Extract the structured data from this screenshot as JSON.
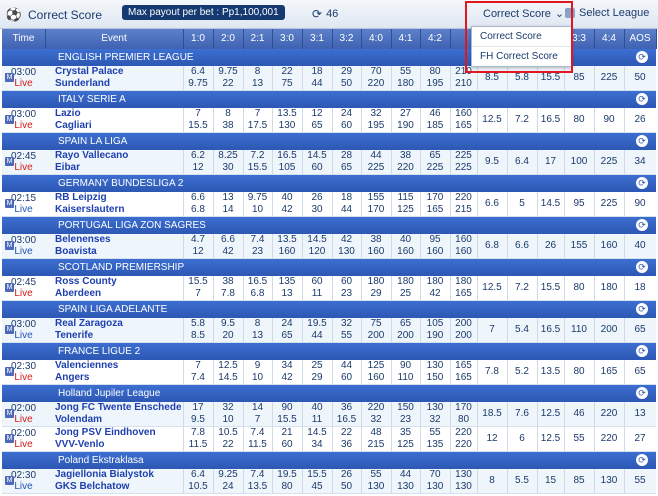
{
  "topbar": {
    "title": "Correct Score",
    "max_payout": "Max payout per bet : Pp1,100,001",
    "refresh_count": "46",
    "dropdown_label": "Correct Score",
    "select_league": "Select League"
  },
  "dropdown_menu": {
    "items": [
      "Correct Score",
      "FH Correct Score"
    ]
  },
  "columns": [
    "Time",
    "Event",
    "1:0",
    "2:0",
    "2:1",
    "3:0",
    "3:1",
    "3:2",
    "4:0",
    "4:1",
    "4:2",
    "",
    "",
    "",
    "",
    "3:3",
    "4:4",
    "AOS"
  ],
  "leagues": [
    {
      "name": "ENGLISH PREMIER LEAGUE",
      "matches": [
        {
          "time": "03:00",
          "status": "Live",
          "home": "Crystal Palace",
          "away": "Sunderland",
          "home_odds": [
            "6.4",
            "9.75",
            "8",
            "22",
            "18",
            "29",
            "70",
            "55",
            "80",
            "210"
          ],
          "away_odds": [
            "9.75",
            "22",
            "13",
            "75",
            "44",
            "50",
            "220",
            "180",
            "195",
            "210"
          ],
          "extra": [
            "8.5",
            "5.8",
            "15.5",
            "85",
            "225",
            "50"
          ]
        }
      ]
    },
    {
      "name": "ITALY SERIE A",
      "matches": [
        {
          "time": "03:00",
          "status": "Live",
          "home": "Lazio",
          "away": "Cagliari",
          "home_odds": [
            "7",
            "8",
            "7",
            "13.5",
            "12",
            "24",
            "32",
            "27",
            "46",
            "160"
          ],
          "away_odds": [
            "15.5",
            "38",
            "17.5",
            "130",
            "65",
            "60",
            "195",
            "190",
            "185",
            "165"
          ],
          "extra": [
            "12.5",
            "7.2",
            "16.5",
            "80",
            "90",
            "26"
          ]
        }
      ]
    },
    {
      "name": "SPAIN LA LIGA",
      "matches": [
        {
          "time": "02:45",
          "status": "Live",
          "home": "Rayo Vallecano",
          "away": "Eibar",
          "home_odds": [
            "6.2",
            "8.25",
            "7.2",
            "16.5",
            "14.5",
            "28",
            "44",
            "38",
            "65",
            "225"
          ],
          "away_odds": [
            "12",
            "30",
            "15.5",
            "105",
            "60",
            "65",
            "225",
            "220",
            "225",
            "225"
          ],
          "extra": [
            "9.5",
            "6.4",
            "17",
            "100",
            "225",
            "34"
          ]
        }
      ]
    },
    {
      "name": "GERMANY BUNDESLIGA 2",
      "matches": [
        {
          "time": "02:15",
          "status": "Live",
          "home": "RB Leipzig",
          "away": "Kaiserslautern",
          "home_odds": [
            "6.6",
            "13",
            "9.75",
            "40",
            "26",
            "18",
            "155",
            "115",
            "170",
            "220"
          ],
          "away_odds": [
            "6.8",
            "14",
            "10",
            "42",
            "30",
            "44",
            "170",
            "125",
            "165",
            "215"
          ],
          "extra": [
            "6.6",
            "5",
            "14.5",
            "95",
            "225",
            "90"
          ]
        }
      ]
    },
    {
      "name": "PORTUGAL LIGA ZON SAGRES",
      "matches": [
        {
          "time": "03:00",
          "status": "Live",
          "home": "Belenenses",
          "away": "Boavista",
          "home_odds": [
            "4.7",
            "6.6",
            "7.4",
            "13.5",
            "14.5",
            "42",
            "38",
            "40",
            "95",
            "160"
          ],
          "away_odds": [
            "12",
            "42",
            "23",
            "160",
            "120",
            "130",
            "160",
            "160",
            "160",
            "160"
          ],
          "extra": [
            "6.8",
            "6.6",
            "26",
            "155",
            "160",
            "40"
          ]
        }
      ]
    },
    {
      "name": "SCOTLAND PREMIERSHIP",
      "matches": [
        {
          "time": "02:45",
          "status": "Live",
          "home": "Ross County",
          "away": "Aberdeen",
          "home_odds": [
            "15.5",
            "38",
            "16.5",
            "135",
            "60",
            "60",
            "180",
            "180",
            "180",
            "180"
          ],
          "away_odds": [
            "7",
            "7.8",
            "6.8",
            "13",
            "11",
            "23",
            "29",
            "25",
            "42",
            "165"
          ],
          "extra": [
            "12.5",
            "7.2",
            "15.5",
            "80",
            "180",
            "18"
          ]
        }
      ]
    },
    {
      "name": "SPAIN LIGA ADELANTE",
      "matches": [
        {
          "time": "03:00",
          "status": "Live",
          "home": "Real Zaragoza",
          "away": "Tenerife",
          "home_odds": [
            "5.8",
            "9.5",
            "8",
            "24",
            "19.5",
            "32",
            "75",
            "65",
            "105",
            "200"
          ],
          "away_odds": [
            "8.5",
            "20",
            "13",
            "65",
            "44",
            "55",
            "200",
            "200",
            "190",
            "200"
          ],
          "extra": [
            "7",
            "5.4",
            "16.5",
            "110",
            "200",
            "65"
          ]
        }
      ]
    },
    {
      "name": "FRANCE LIGUE 2",
      "matches": [
        {
          "time": "02:30",
          "status": "Live",
          "home": "Valenciennes",
          "away": "Angers",
          "home_odds": [
            "7",
            "12.5",
            "9",
            "34",
            "25",
            "44",
            "125",
            "90",
            "130",
            "165"
          ],
          "away_odds": [
            "7.4",
            "14.5",
            "10",
            "42",
            "29",
            "60",
            "160",
            "110",
            "150",
            "165"
          ],
          "extra": [
            "7.8",
            "5.2",
            "13.5",
            "80",
            "165",
            "65"
          ]
        }
      ]
    },
    {
      "name": "Holland Jupiler League",
      "matches": [
        {
          "time": "02:00",
          "status": "Live",
          "home": "Jong FC Twente Enschede",
          "away": "Volendam",
          "home_odds": [
            "17",
            "32",
            "14",
            "90",
            "40",
            "36",
            "220",
            "150",
            "130",
            "170"
          ],
          "away_odds": [
            "9.5",
            "10",
            "7",
            "15.5",
            "11",
            "16.5",
            "32",
            "23",
            "32",
            "80"
          ],
          "extra": [
            "18.5",
            "7.6",
            "12.5",
            "46",
            "220",
            "13"
          ]
        },
        {
          "time": "02:00",
          "status": "Live",
          "home": "Jong PSV Eindhoven",
          "away": "VVV-Venlo",
          "home_odds": [
            "7.8",
            "10.5",
            "7.4",
            "21",
            "14.5",
            "22",
            "48",
            "35",
            "55",
            "220"
          ],
          "away_odds": [
            "11.5",
            "22",
            "11.5",
            "60",
            "34",
            "36",
            "215",
            "125",
            "135",
            "220"
          ],
          "extra": [
            "12",
            "6",
            "12.5",
            "55",
            "220",
            "27"
          ]
        }
      ]
    },
    {
      "name": "Poland Ekstraklasa",
      "matches": [
        {
          "time": "02:30",
          "status": "Live",
          "home": "Jagiellonia Bialystok",
          "away": "GKS Belchatow",
          "home_odds": [
            "6.4",
            "9.25",
            "7.4",
            "19.5",
            "15.5",
            "26",
            "55",
            "44",
            "70",
            "130"
          ],
          "away_odds": [
            "10.5",
            "24",
            "13.5",
            "80",
            "45",
            "50",
            "130",
            "130",
            "130",
            "130"
          ],
          "extra": [
            "8",
            "5.5",
            "15",
            "85",
            "130",
            "55"
          ]
        }
      ]
    }
  ]
}
